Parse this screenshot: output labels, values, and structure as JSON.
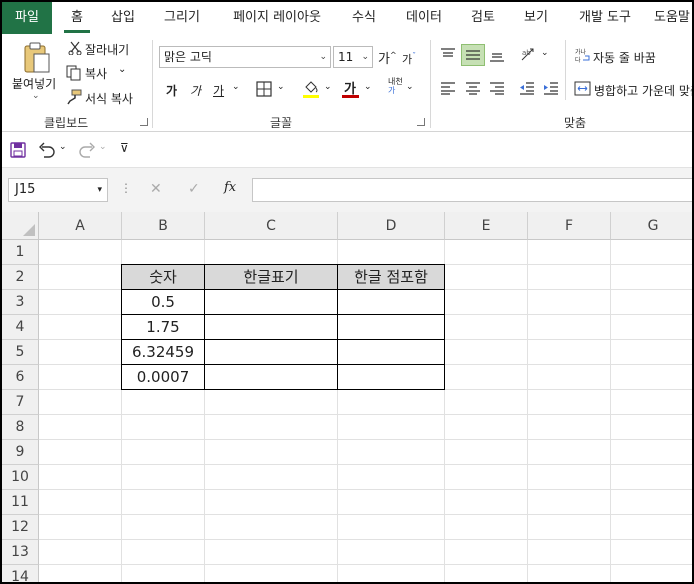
{
  "tabs": [
    "파일",
    "홈",
    "삽입",
    "그리기",
    "페이지 레이아웃",
    "수식",
    "데이터",
    "검토",
    "보기",
    "개발 도구",
    "도움말"
  ],
  "ribbon": {
    "clipboard": {
      "paste": "붙여넣기",
      "cut": "잘라내기",
      "copy": "복사",
      "format_painter": "서식 복사",
      "group": "클립보드"
    },
    "font": {
      "name": "맑은 고딕",
      "size": "11",
      "grow": "가",
      "shrink": "가",
      "bold": "가",
      "italic": "가",
      "underline": "가",
      "font_color_glyph": "가",
      "phonetic": "내천",
      "group": "글꼴"
    },
    "alignment": {
      "wrap_text": "자동 줄 바꿈",
      "merge": "병합하고 가운데 맞춤",
      "group": "맞춤"
    },
    "colors": {
      "accent": "#217346",
      "font_color": "#c00000",
      "fill_color": "#ffff00"
    }
  },
  "formula_bar": {
    "name_box": "J15",
    "cancel": "✕",
    "enter": "✓",
    "fx": "fx",
    "value": ""
  },
  "sheet": {
    "columns": [
      "A",
      "B",
      "C",
      "D",
      "E",
      "F",
      "G"
    ],
    "rows": [
      "1",
      "2",
      "3",
      "4",
      "5",
      "6",
      "7",
      "8",
      "9",
      "10",
      "11",
      "12",
      "13",
      "14"
    ],
    "table": {
      "headers": [
        "숫자",
        "한글표기",
        "한글 점포함"
      ],
      "rows": [
        [
          "0.5",
          "",
          ""
        ],
        [
          "1.75",
          "",
          ""
        ],
        [
          "6.32459",
          "",
          ""
        ],
        [
          "0.0007",
          "",
          ""
        ]
      ]
    }
  }
}
